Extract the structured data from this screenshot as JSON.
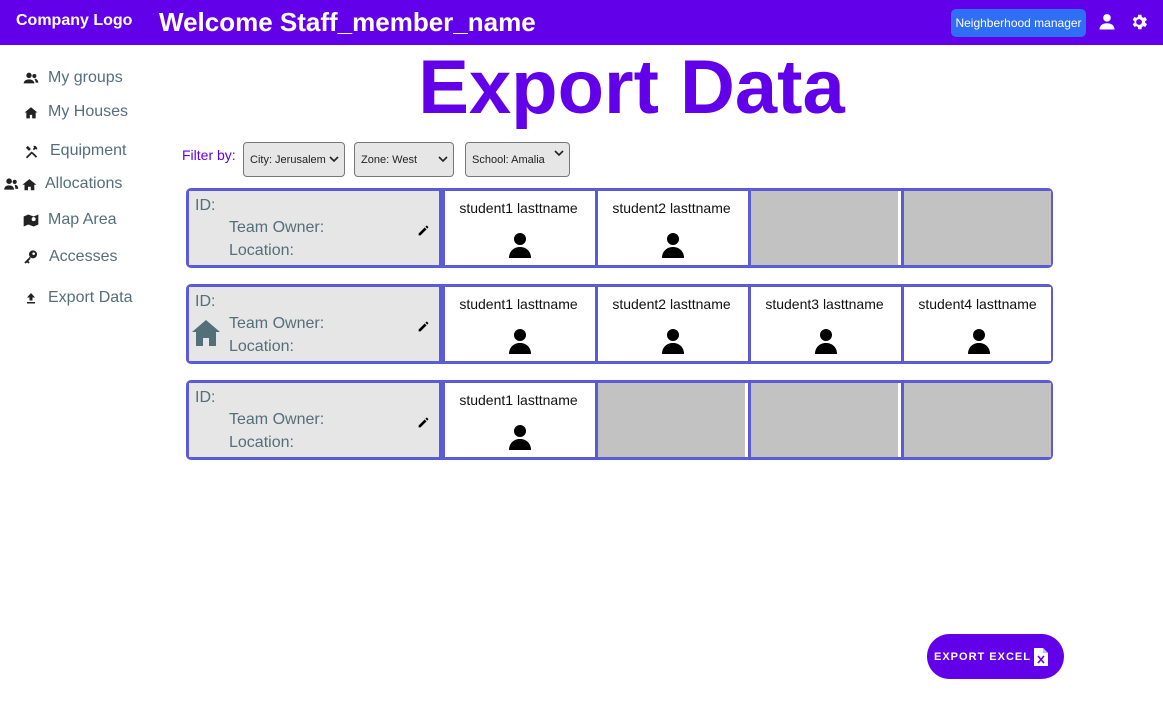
{
  "header": {
    "logo": "Company Logo",
    "welcome": "Welcome Staff_member_name",
    "role_button": "Neighberhood manager",
    "icons": [
      "user-icon",
      "gear-icon"
    ]
  },
  "sidebar": {
    "items": [
      {
        "label": "My groups",
        "icon": "group-icon"
      },
      {
        "label": "My Houses",
        "icon": "house-icon"
      },
      {
        "label": "Equipment",
        "icon": "tools-icon"
      },
      {
        "label": "Allocations",
        "icon": "group-house-icon"
      },
      {
        "label": "Map Area",
        "icon": "map-icon"
      },
      {
        "label": "Accesses",
        "icon": "key-icon"
      },
      {
        "label": "Export Data",
        "icon": "upload-icon"
      }
    ]
  },
  "page": {
    "title": "Export Data"
  },
  "filters": {
    "label": "Filter by:",
    "city": "City: Jerusalem",
    "zone": "Zone: West",
    "school": "School: Amalia"
  },
  "groups": [
    {
      "id_label": "ID:",
      "owner_label": "Team Owner:",
      "location_label": "Location:",
      "members": [
        "student1 lasttname",
        "student2 lasttname"
      ]
    },
    {
      "id_label": "ID:",
      "owner_label": "Team Owner:",
      "location_label": "Location:",
      "members": [
        "student1 lasttname",
        "student2 lasttname",
        "student3 lasttname",
        "student4 lasttname"
      ]
    },
    {
      "id_label": "ID:",
      "owner_label": "Team Owner:",
      "location_label": "Location:",
      "members": [
        "student1 lasttname"
      ]
    }
  ],
  "export": {
    "label": "EXPORT EXCEL"
  },
  "colors": {
    "primary": "#6200ea",
    "role_button": "#2f6ff5",
    "border": "#5b5bd6",
    "info_bg": "#e6e6e6",
    "empty_slot": "#c2c2c2",
    "muted_text": "#546e7a"
  }
}
